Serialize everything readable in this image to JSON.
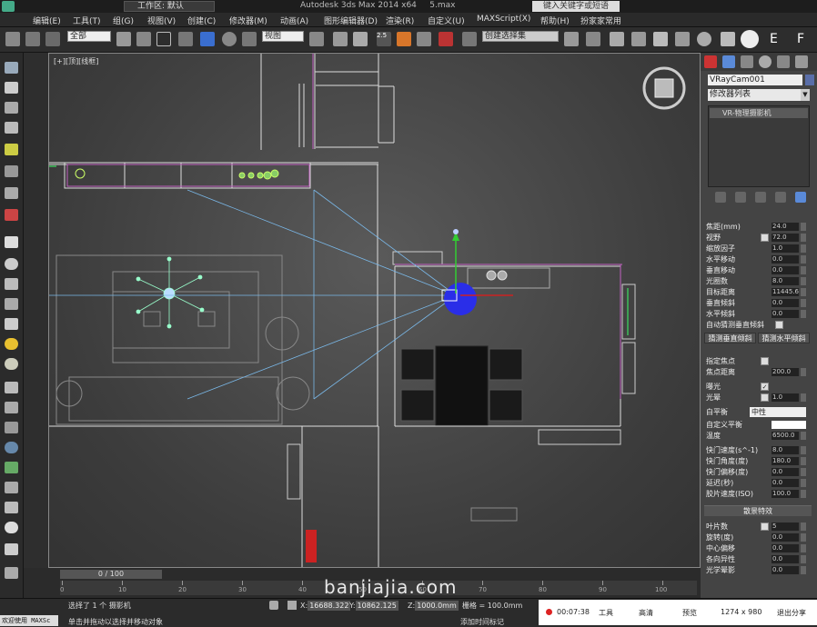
{
  "titlebar": {
    "workspace": "工作区: 默认",
    "title": "Autodesk 3ds Max  2014 x64",
    "file": "5.max",
    "search_placeholder": "键入关键字或短语"
  },
  "menu": [
    "编辑(E)",
    "工具(T)",
    "组(G)",
    "视图(V)",
    "创建(C)",
    "修改器(M)",
    "动画(A)",
    "图形编辑器(D)",
    "渲染(R)",
    "自定义(U)",
    "MAXScript(X)",
    "帮助(H)",
    "扮家家常用"
  ],
  "toolbar": {
    "selection_filter": "全部",
    "ref_coord": "视图",
    "named_sel": "创建选择集",
    "snap_value": "2.5"
  },
  "viewport": {
    "label": "[+][顶][线框]"
  },
  "panel": {
    "object_name": "VRayCam001",
    "modifier_list": "修改器列表",
    "stack_item": "VR-物理摄影机",
    "params": [
      {
        "label": "焦距(mm)",
        "value": "24.0"
      },
      {
        "label": "视野",
        "value": "72.0",
        "check": true
      },
      {
        "label": "缩放因子",
        "value": "1.0"
      },
      {
        "label": "水平移动",
        "value": "0.0"
      },
      {
        "label": "垂直移动",
        "value": "0.0"
      },
      {
        "label": "光圈数",
        "value": "8.0"
      },
      {
        "label": "目标距离",
        "value": "11445.6"
      },
      {
        "label": "垂直倾斜",
        "value": "0.0"
      },
      {
        "label": "水平倾斜",
        "value": "0.0"
      },
      {
        "label": "自动猜测垂直倾斜",
        "check": true
      }
    ],
    "guess_vert": "猜测垂直倾斜",
    "guess_horiz": "猜测水平倾斜",
    "params2": [
      {
        "label": "指定焦点",
        "check": true
      },
      {
        "label": "焦点距离",
        "value": "200.0"
      },
      {
        "label": "曝光",
        "check": true,
        "checked": "✓"
      },
      {
        "label": "光晕",
        "check": true,
        "value": "1.0"
      }
    ],
    "white_balance_label": "白平衡",
    "white_balance_value": "中性",
    "custom_wb": "自定义平衡",
    "temperature_label": "温度",
    "temperature_value": "6500.0",
    "params3": [
      {
        "label": "快门速度(s^-1)",
        "value": "8.0"
      },
      {
        "label": "快门角度(度)",
        "value": "180.0"
      },
      {
        "label": "快门偏移(度)",
        "value": "0.0"
      },
      {
        "label": "延迟(秒)",
        "value": "0.0"
      },
      {
        "label": "胶片速度(ISO)",
        "value": "100.0"
      }
    ],
    "bokeh_section": "散景特效",
    "params4": [
      {
        "label": "叶片数",
        "value": "5",
        "check": true
      },
      {
        "label": "旋转(度)",
        "value": "0.0"
      },
      {
        "label": "中心偏移",
        "value": "0.0"
      },
      {
        "label": "各向异性",
        "value": "0.0"
      },
      {
        "label": "光学晕影",
        "value": "0.0"
      }
    ]
  },
  "timeline": {
    "frame": "0 / 100",
    "ticks": [
      "0",
      "10",
      "20",
      "30",
      "40",
      "50",
      "60",
      "70",
      "80",
      "90",
      "100"
    ]
  },
  "status": {
    "welcome": "欢迎使用 MAXSc",
    "selected": "选择了 1 个 摄影机",
    "hint": "单击并拖动以选择并移动对象",
    "x_label": "X:",
    "x_value": "16688.322",
    "y_label": "Y:",
    "y_value": "10862.125",
    "z_label": "Z:",
    "z_value": "1000.0mm",
    "grid": "栅格 = 100.0mm",
    "add_tag": "添加时间标记"
  },
  "recorder": {
    "time": "00:07:38",
    "tools": "工具",
    "quality": "高清",
    "preview": "预览",
    "resolution": "1274 x 980",
    "exit": "退出分享"
  },
  "watermark": "banjiajia.com"
}
